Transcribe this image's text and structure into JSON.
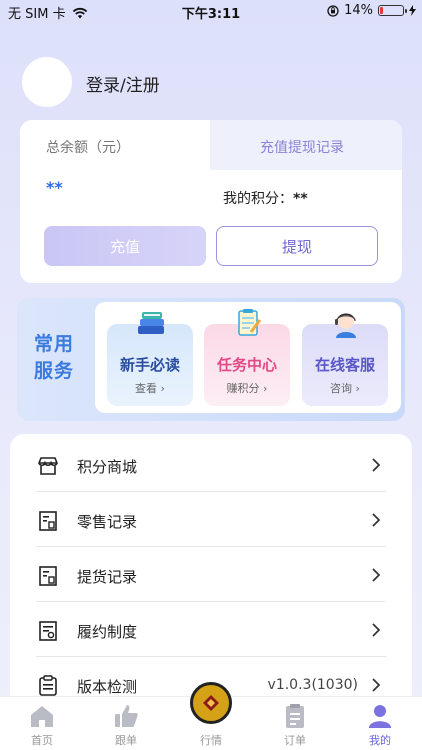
{
  "status_bar": {
    "carrier": "无 SIM 卡",
    "time": "下午3:11",
    "battery": "14%",
    "battery_level": 0.14
  },
  "user": {
    "login_label": "登录/注册"
  },
  "balance": {
    "label": "总余额（元）",
    "record_link": "充值提现记录",
    "value": "**",
    "points_label": "我的积分：",
    "points_value": "**",
    "recharge_button": "充值",
    "withdraw_button": "提现"
  },
  "services": {
    "title": "常用服务",
    "items": [
      {
        "title": "新手必读",
        "sub": "查看 ›",
        "icon": "books-icon"
      },
      {
        "title": "任务中心",
        "sub": "赚积分 ›",
        "icon": "task-clipboard-icon"
      },
      {
        "title": "在线客服",
        "sub": "咨询 ›",
        "icon": "customer-service-agent-icon"
      }
    ]
  },
  "menu": {
    "items": [
      {
        "label": "积分商城",
        "value": "",
        "icon": "store-icon"
      },
      {
        "label": "零售记录",
        "value": "",
        "icon": "record-document-icon"
      },
      {
        "label": "提货记录",
        "value": "",
        "icon": "record-document-icon"
      },
      {
        "label": "履约制度",
        "value": "",
        "icon": "contract-document-icon"
      },
      {
        "label": "版本检测",
        "value": "v1.0.3(1030)",
        "icon": "version-check-icon"
      }
    ]
  },
  "tabbar": {
    "items": [
      {
        "label": "首页",
        "icon": "home-icon",
        "active": false
      },
      {
        "label": "跟单",
        "icon": "thumbs-up-icon",
        "active": false
      },
      {
        "label": "行情",
        "icon": "market-center-icon",
        "active": false
      },
      {
        "label": "订单",
        "icon": "order-clipboard-icon",
        "active": false
      },
      {
        "label": "我的",
        "icon": "profile-icon",
        "active": true
      }
    ]
  },
  "colors": {
    "accent": "#6a64d8",
    "blue": "#2e6de6",
    "background": "#dde0fa"
  }
}
